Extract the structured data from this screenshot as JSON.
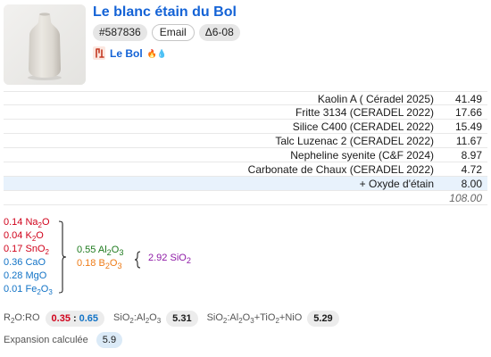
{
  "recipe": {
    "title": "Le blanc étain du Bol",
    "id": "#587836",
    "email_label": "Email",
    "delta": "Δ6-08",
    "owner": "Le Bol",
    "owner_flames": "🔥💧"
  },
  "ingredients": [
    {
      "name": "Kaolin A ( Céradel 2025)",
      "amount": "41.49"
    },
    {
      "name": "Fritte 3134 (CERADEL 2022)",
      "amount": "17.66"
    },
    {
      "name": "Silice C400 (CERADEL 2022)",
      "amount": "15.49"
    },
    {
      "name": "Talc Luzenac 2 (CERADEL 2022)",
      "amount": "11.67"
    },
    {
      "name": "Nepheline syenite (C&F 2024)",
      "amount": "8.97"
    },
    {
      "name": "Carbonate de Chaux (CERADEL 2022)",
      "amount": "4.72"
    }
  ],
  "additions": [
    {
      "name": "+ Oxyde d'étain",
      "amount": "8.00"
    }
  ],
  "total": "108.00",
  "unity_formula": {
    "fluxes": [
      {
        "amount": "0.14",
        "oxide": "Na",
        "sub": "2",
        "tail": "O",
        "color": "red"
      },
      {
        "amount": "0.04",
        "oxide": "K",
        "sub": "2",
        "tail": "O",
        "color": "red"
      },
      {
        "amount": "0.17",
        "oxide": "SnO",
        "sub": "2",
        "tail": "",
        "color": "red"
      },
      {
        "amount": "0.36",
        "oxide": "CaO",
        "sub": "",
        "tail": "",
        "color": "blue"
      },
      {
        "amount": "0.28",
        "oxide": "MgO",
        "sub": "",
        "tail": "",
        "color": "blue"
      },
      {
        "amount": "0.01",
        "oxide": "Fe",
        "sub": "2",
        "tail": "O",
        "sub2": "3",
        "color": "blue"
      }
    ],
    "stabilizers": [
      {
        "amount": "0.55",
        "oxide": "Al",
        "sub": "2",
        "tail": "O",
        "sub2": "3",
        "color": "green"
      },
      {
        "amount": "0.18",
        "oxide": "B",
        "sub": "2",
        "tail": "O",
        "sub2": "3",
        "color": "orange"
      }
    ],
    "glass_formers": {
      "amount": "2.92",
      "oxide": "SiO",
      "sub": "2",
      "color": "purple"
    }
  },
  "ratios": {
    "r2o_ro_label": "R2O:RO",
    "r2o": "0.35",
    "ro": "0.65",
    "si_al_label": "SiO2:Al2O3",
    "si_al": "5.31",
    "si_al_ti_ni_label": "SiO2:Al2O3+TiO2+NiO",
    "si_al_ti_ni": "5.29"
  },
  "expansion": {
    "label": "Expansion calculée",
    "value": "5.9"
  },
  "colors": {
    "link": "#1463d6",
    "flux_r2o": "#d0021b",
    "flux_ro": "#1273c6",
    "alumina": "#1e7a1e",
    "boron": "#ee7b16",
    "silica": "#8e1aa6",
    "addition_row": "#e8f2fc"
  }
}
